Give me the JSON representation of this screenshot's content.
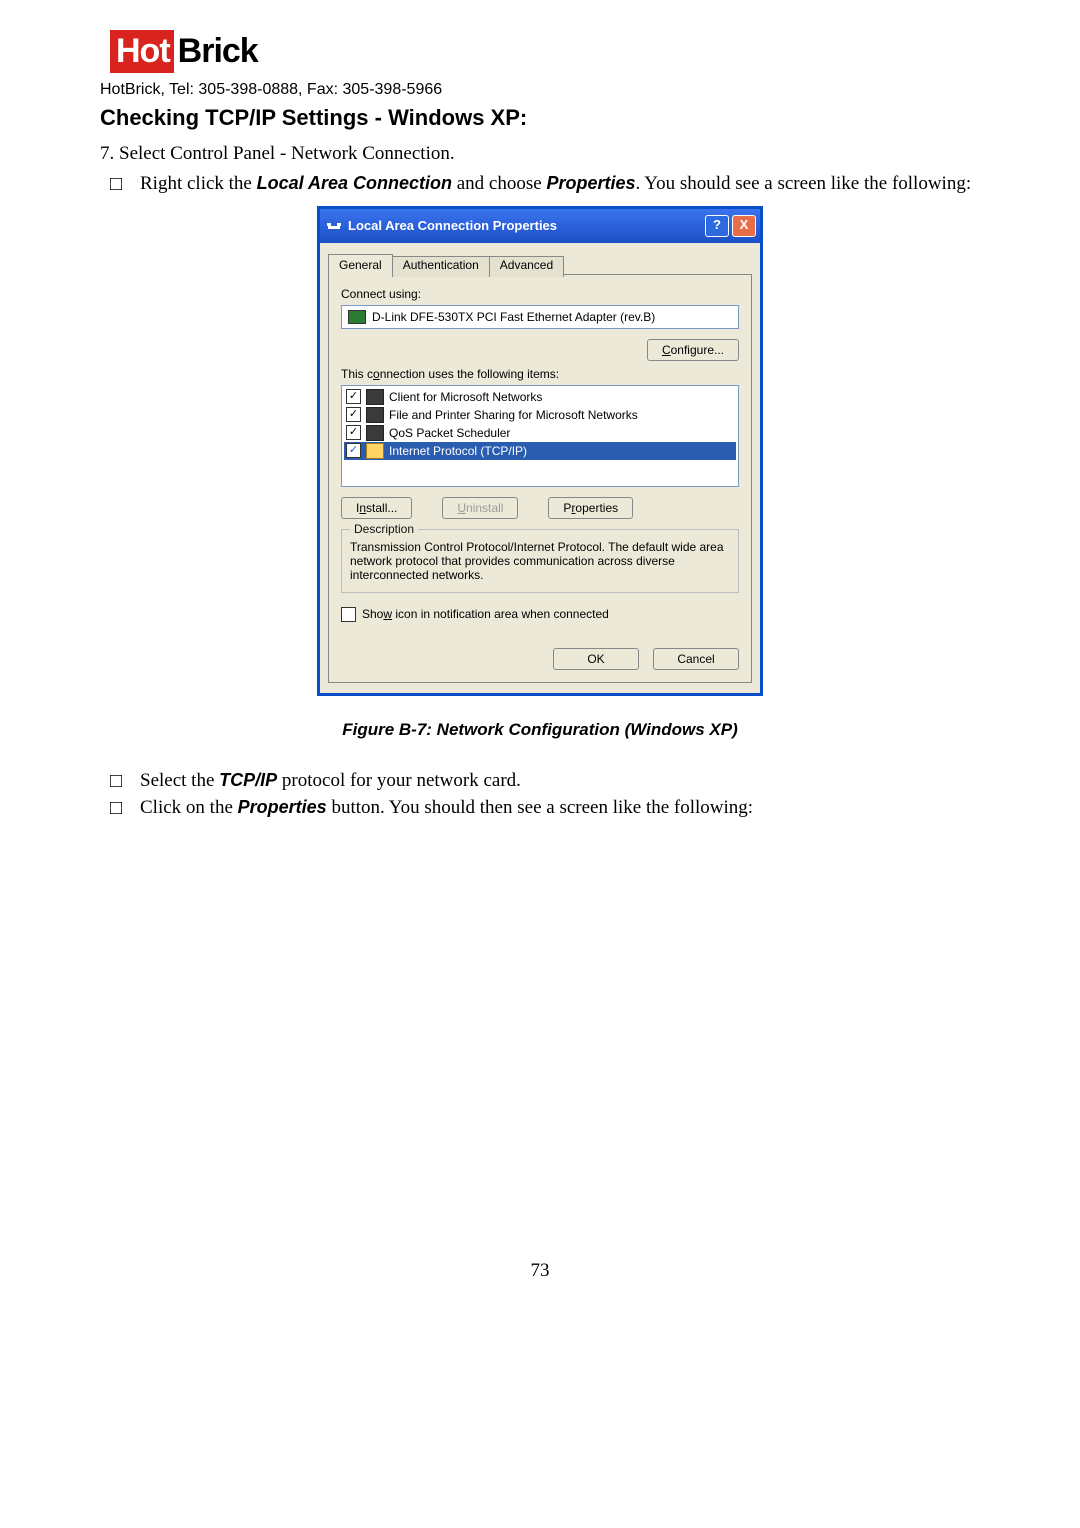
{
  "logo": {
    "hot": "Hot",
    "brick": "Brick"
  },
  "subhead": "HotBrick, Tel: 305-398-0888, Fax: 305-398-5966",
  "heading": "Checking TCP/IP Settings - Windows XP:",
  "line7": "7. Select Control Panel - Network Connection.",
  "bullet_a_pre": "Right click the ",
  "bullet_a_em1": "Local Area Connection",
  "bullet_a_mid": " and choose ",
  "bullet_a_em2": "Properties",
  "bullet_a_post": ". You should see a screen like the following:",
  "dialog": {
    "title": "Local Area Connection Properties",
    "help": "?",
    "close": "X",
    "tabs": {
      "general": "General",
      "auth": "Authentication",
      "adv": "Advanced"
    },
    "connect_using": "Connect using:",
    "adapter": "D-Link DFE-530TX PCI Fast Ethernet Adapter (rev.B)",
    "configure": "Configure...",
    "uses_items": "This connection uses the following items:",
    "items": {
      "client": "Client for Microsoft Networks",
      "fileprint": "File and Printer Sharing for Microsoft Networks",
      "qos": "QoS Packet Scheduler",
      "tcpip": "Internet Protocol (TCP/IP)"
    },
    "install": "Install...",
    "uninstall": "Uninstall",
    "properties": "Properties",
    "desc_legend": "Description",
    "desc_text": "Transmission Control Protocol/Internet Protocol. The default wide area network protocol that provides communication across diverse interconnected networks.",
    "show_icon": "Show icon in notification area when connected",
    "ok": "OK",
    "cancel": "Cancel"
  },
  "figure_caption": "Figure B-7: Network Configuration (Windows XP)",
  "bullet_b_pre": "Select the ",
  "bullet_b_em": "TCP/IP",
  "bullet_b_post": " protocol for your network card.",
  "bullet_c_pre": "Click on the ",
  "bullet_c_em": "Properties",
  "bullet_c_post": " button. You should then see a screen like the following:",
  "page_number": "73",
  "check": "✓"
}
